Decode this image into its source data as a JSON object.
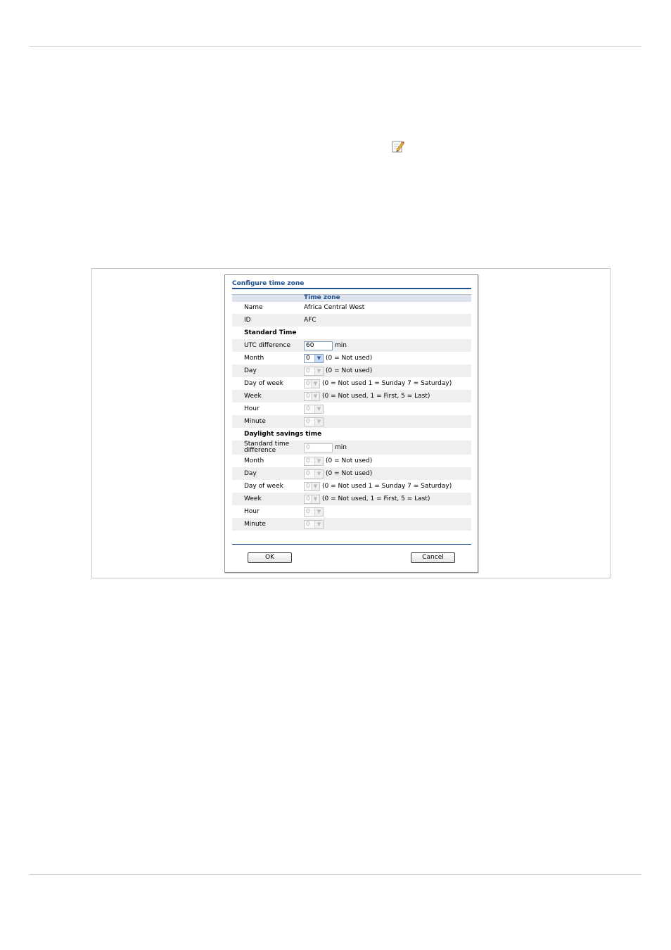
{
  "dialog": {
    "title": "Configure time zone",
    "section_header": "Time zone",
    "name_label": "Name",
    "name_value": "Africa Central West",
    "id_label": "ID",
    "id_value": "AFC",
    "standard": {
      "heading": "Standard Time",
      "utc_label": "UTC difference",
      "utc_value": "60",
      "utc_unit": "min",
      "month_label": "Month",
      "month_value": "0",
      "month_note": "(0 = Not used)",
      "day_label": "Day",
      "day_value": "0",
      "day_note": "(0 = Not used)",
      "dow_label": "Day of week",
      "dow_value": "0",
      "dow_note": "(0 = Not used 1 = Sunday 7 = Saturday)",
      "week_label": "Week",
      "week_value": "0",
      "week_note": "(0 = Not used, 1 = First, 5 = Last)",
      "hour_label": "Hour",
      "hour_value": "0",
      "minute_label": "Minute",
      "minute_value": "0"
    },
    "daylight": {
      "heading": "Daylight savings time",
      "diff_label_1": "Standard time",
      "diff_label_2": "difference",
      "diff_placeholder": "0",
      "diff_unit": "min",
      "month_label": "Month",
      "month_value": "0",
      "month_note": "(0 = Not used)",
      "day_label": "Day",
      "day_value": "0",
      "day_note": "(0 = Not used)",
      "dow_label": "Day of week",
      "dow_value": "0",
      "dow_note": "(0 = Not used 1 = Sunday 7 = Saturday)",
      "week_label": "Week",
      "week_value": "0",
      "week_note": "(0 = Not used, 1 = First, 5 = Last)",
      "hour_label": "Hour",
      "hour_value": "0",
      "minute_label": "Minute",
      "minute_value": "0"
    },
    "ok_label": "OK",
    "cancel_label": "Cancel"
  },
  "icons": {
    "edit": "pencil-edit-icon"
  },
  "colors": {
    "accent": "#1e4f8f",
    "row_shade": "#efefef",
    "header_band": "#dde3ec"
  }
}
